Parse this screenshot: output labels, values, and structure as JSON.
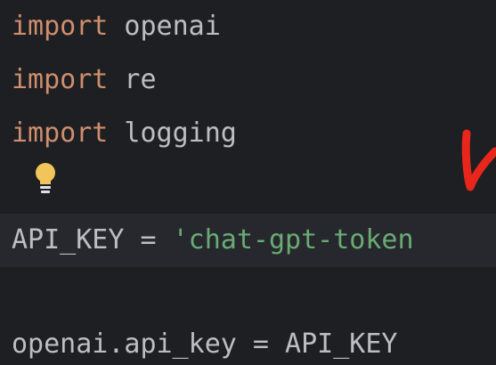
{
  "editor": {
    "lines": [
      {
        "keyword": "import",
        "rest": " openai"
      },
      {
        "keyword": "import",
        "rest": " re"
      },
      {
        "keyword": "import",
        "rest": " logging"
      },
      {
        "code": "API_KEY = ",
        "string": "'chat-gpt-token"
      },
      {
        "code": ""
      },
      {
        "code": "openai.api_key = API_KEY"
      }
    ]
  },
  "icons": {
    "gutter_hint": "lightbulb-icon",
    "annotation": "red-handwritten-mark"
  },
  "colors": {
    "background": "#1e1f22",
    "current_line": "#26282e",
    "keyword": "#cf8e6d",
    "string": "#6aab73",
    "text": "#bcbec4",
    "bulb": "#f2c55c",
    "annotation": "#e8261c"
  }
}
